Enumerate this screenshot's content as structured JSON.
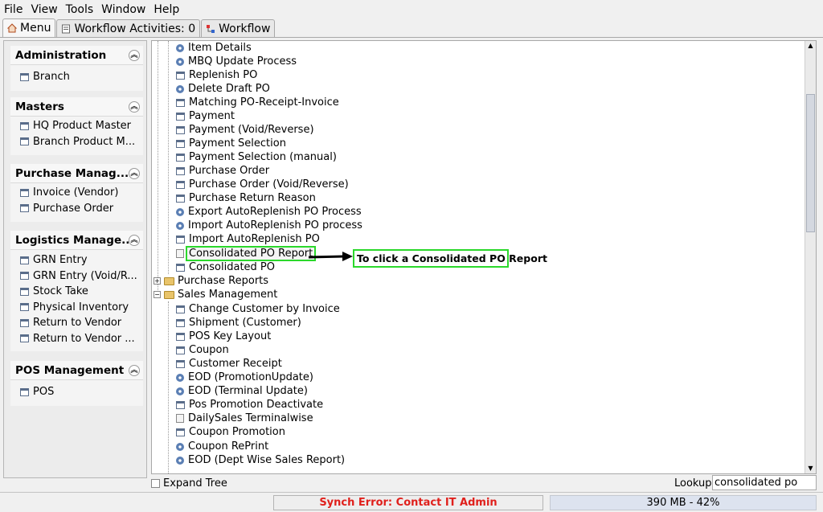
{
  "menubar": {
    "items": [
      "File",
      "View",
      "Tools",
      "Window",
      "Help"
    ]
  },
  "tabs": [
    {
      "label": "Menu",
      "icon": "home-icon"
    },
    {
      "label": "Workflow Activities: 0",
      "icon": "document-icon"
    },
    {
      "label": "Workflow",
      "icon": "workflow-icon"
    }
  ],
  "sidebar": {
    "groups": [
      {
        "title": "Administration",
        "items": [
          "Branch"
        ]
      },
      {
        "title": "Masters",
        "items": [
          "HQ Product Master",
          "Branch Product M..."
        ]
      },
      {
        "title": "Purchase Manag...",
        "items": [
          "Invoice (Vendor)",
          "Purchase Order"
        ]
      },
      {
        "title": "Logistics Manage...",
        "items": [
          "GRN Entry",
          "GRN Entry (Void/R...",
          "Stock Take",
          "Physical Inventory",
          "Return to Vendor",
          "Return to Vendor ..."
        ]
      },
      {
        "title": "POS Management",
        "items": [
          "POS"
        ]
      }
    ]
  },
  "tree": {
    "items": [
      {
        "label": "Item Details",
        "icon": "gear-icon"
      },
      {
        "label": "MBQ Update Process",
        "icon": "gear-icon"
      },
      {
        "label": "Replenish PO",
        "icon": "window-icon"
      },
      {
        "label": "Delete Draft PO",
        "icon": "gear-icon"
      },
      {
        "label": "Matching PO-Receipt-Invoice",
        "icon": "window-icon"
      },
      {
        "label": "Payment",
        "icon": "window-icon"
      },
      {
        "label": "Payment (Void/Reverse)",
        "icon": "window-icon"
      },
      {
        "label": "Payment Selection",
        "icon": "window-icon"
      },
      {
        "label": "Payment Selection (manual)",
        "icon": "window-icon"
      },
      {
        "label": "Purchase Order",
        "icon": "window-icon"
      },
      {
        "label": "Purchase Order (Void/Reverse)",
        "icon": "window-icon"
      },
      {
        "label": "Purchase Return Reason",
        "icon": "window-icon"
      },
      {
        "label": "Export AutoReplenish PO Process",
        "icon": "gear-icon"
      },
      {
        "label": "Import AutoReplenish PO process",
        "icon": "gear-icon"
      },
      {
        "label": "Import AutoReplenish PO",
        "icon": "window-icon"
      },
      {
        "label": "Consolidated PO Report",
        "icon": "report-icon"
      },
      {
        "label": "Consolidated PO",
        "icon": "window-icon"
      }
    ],
    "folders": [
      {
        "label": "Purchase Reports",
        "expanded": false
      },
      {
        "label": "Sales Management",
        "expanded": true
      }
    ],
    "sales_items": [
      {
        "label": "Change Customer by Invoice",
        "icon": "window-icon"
      },
      {
        "label": "Shipment (Customer)",
        "icon": "window-icon"
      },
      {
        "label": "POS Key Layout",
        "icon": "window-icon"
      },
      {
        "label": "Coupon",
        "icon": "window-icon"
      },
      {
        "label": "Customer Receipt",
        "icon": "window-icon"
      },
      {
        "label": "EOD (PromotionUpdate)",
        "icon": "gear-icon"
      },
      {
        "label": "EOD (Terminal Update)",
        "icon": "gear-icon"
      },
      {
        "label": "Pos Promotion Deactivate",
        "icon": "window-icon"
      },
      {
        "label": "DailySales Terminalwise",
        "icon": "report-icon"
      },
      {
        "label": "Coupon Promotion",
        "icon": "window-icon"
      },
      {
        "label": "Coupon RePrint",
        "icon": "gear-icon"
      },
      {
        "label": "EOD (Dept Wise Sales Report)",
        "icon": "gear-icon"
      }
    ]
  },
  "annotation": {
    "text": "To click a Consolidated PO Report",
    "color": "#2bd82b"
  },
  "bottom": {
    "expand_tree_label": "Expand Tree",
    "lookup_label": "Lookup",
    "lookup_value": "consolidated po"
  },
  "status": {
    "sync_error": "Synch Error: Contact IT Admin",
    "memory": "390 MB - 42%"
  }
}
